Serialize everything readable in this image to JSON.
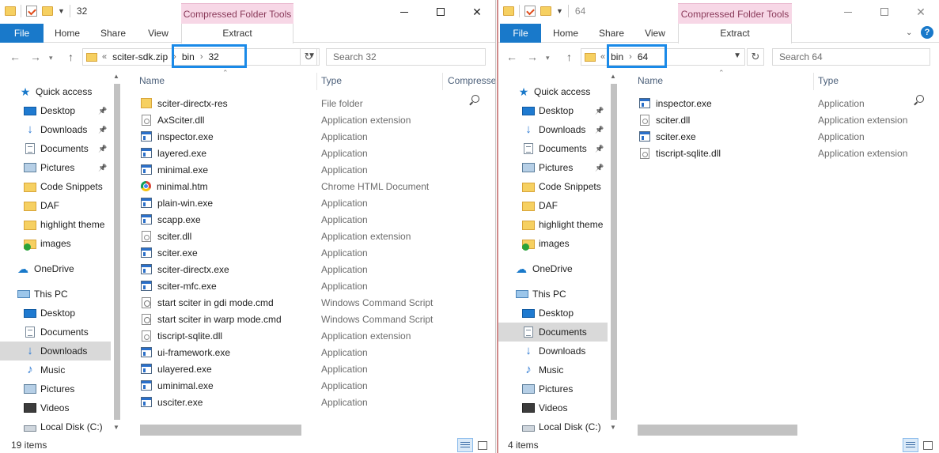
{
  "left": {
    "title": "32",
    "context_tab": "Compressed Folder Tools",
    "tabs": {
      "file": "File",
      "home": "Home",
      "share": "Share",
      "view": "View",
      "extract": "Extract"
    },
    "address": {
      "overflow": "«",
      "seg1": "sciter-sdk.zip",
      "seg2": "bin",
      "seg3": "32"
    },
    "search_placeholder": "Search 32",
    "nav": [
      {
        "label": "Quick access",
        "icon": "quick-access-star-icon"
      },
      {
        "label": "Desktop",
        "icon": "desktop-icon",
        "pinned": true
      },
      {
        "label": "Downloads",
        "icon": "downloads-icon",
        "pinned": true
      },
      {
        "label": "Documents",
        "icon": "documents-icon",
        "pinned": true
      },
      {
        "label": "Pictures",
        "icon": "pictures-icon",
        "pinned": true
      },
      {
        "label": "Code Snippets",
        "icon": "folder-icon"
      },
      {
        "label": "DAF",
        "icon": "folder-icon"
      },
      {
        "label": "highlight theme",
        "icon": "folder-icon"
      },
      {
        "label": "images",
        "icon": "folder-synced-icon"
      },
      {
        "label": "OneDrive",
        "icon": "onedrive-icon"
      },
      {
        "label": "This PC",
        "icon": "this-pc-icon"
      },
      {
        "label": "Desktop",
        "icon": "desktop-icon"
      },
      {
        "label": "Documents",
        "icon": "documents-icon"
      },
      {
        "label": "Downloads",
        "icon": "downloads-icon",
        "selected": true
      },
      {
        "label": "Music",
        "icon": "music-icon"
      },
      {
        "label": "Pictures",
        "icon": "pictures-icon"
      },
      {
        "label": "Videos",
        "icon": "videos-icon"
      },
      {
        "label": "Local Disk (C:)",
        "icon": "local-disk-icon"
      }
    ],
    "columns": {
      "name": "Name",
      "type": "Type",
      "compressed": "Compresse"
    },
    "files": [
      {
        "name": "sciter-directx-res",
        "type": "File folder",
        "icon": "folder"
      },
      {
        "name": "AxSciter.dll",
        "type": "Application extension",
        "icon": "dll"
      },
      {
        "name": "inspector.exe",
        "type": "Application",
        "icon": "app"
      },
      {
        "name": "layered.exe",
        "type": "Application",
        "icon": "app"
      },
      {
        "name": "minimal.exe",
        "type": "Application",
        "icon": "app"
      },
      {
        "name": "minimal.htm",
        "type": "Chrome HTML Document",
        "icon": "chrome"
      },
      {
        "name": "plain-win.exe",
        "type": "Application",
        "icon": "app"
      },
      {
        "name": "scapp.exe",
        "type": "Application",
        "icon": "app"
      },
      {
        "name": "sciter.dll",
        "type": "Application extension",
        "icon": "dll"
      },
      {
        "name": "sciter.exe",
        "type": "Application",
        "icon": "app"
      },
      {
        "name": "sciter-directx.exe",
        "type": "Application",
        "icon": "app"
      },
      {
        "name": "sciter-mfc.exe",
        "type": "Application",
        "icon": "app"
      },
      {
        "name": "start sciter in gdi mode.cmd",
        "type": "Windows Command Script",
        "icon": "cmd"
      },
      {
        "name": "start sciter in warp mode.cmd",
        "type": "Windows Command Script",
        "icon": "cmd"
      },
      {
        "name": "tiscript-sqlite.dll",
        "type": "Application extension",
        "icon": "dll"
      },
      {
        "name": "ui-framework.exe",
        "type": "Application",
        "icon": "app"
      },
      {
        "name": "ulayered.exe",
        "type": "Application",
        "icon": "app"
      },
      {
        "name": "uminimal.exe",
        "type": "Application",
        "icon": "app"
      },
      {
        "name": "usciter.exe",
        "type": "Application",
        "icon": "app"
      }
    ],
    "status": "19 items"
  },
  "right": {
    "title": "64",
    "context_tab": "Compressed Folder Tools",
    "tabs": {
      "file": "File",
      "home": "Home",
      "share": "Share",
      "view": "View",
      "extract": "Extract"
    },
    "address": {
      "overflow": "«",
      "seg1": "bin",
      "seg2": "64"
    },
    "search_placeholder": "Search 64",
    "nav": [
      {
        "label": "Quick access",
        "icon": "quick-access-star-icon"
      },
      {
        "label": "Desktop",
        "icon": "desktop-icon",
        "pinned": true
      },
      {
        "label": "Downloads",
        "icon": "downloads-icon",
        "pinned": true
      },
      {
        "label": "Documents",
        "icon": "documents-icon",
        "pinned": true
      },
      {
        "label": "Pictures",
        "icon": "pictures-icon",
        "pinned": true
      },
      {
        "label": "Code Snippets",
        "icon": "folder-icon"
      },
      {
        "label": "DAF",
        "icon": "folder-icon"
      },
      {
        "label": "highlight theme",
        "icon": "folder-icon"
      },
      {
        "label": "images",
        "icon": "folder-synced-icon"
      },
      {
        "label": "OneDrive",
        "icon": "onedrive-icon"
      },
      {
        "label": "This PC",
        "icon": "this-pc-icon"
      },
      {
        "label": "Desktop",
        "icon": "desktop-icon"
      },
      {
        "label": "Documents",
        "icon": "documents-icon",
        "selected": true
      },
      {
        "label": "Downloads",
        "icon": "downloads-icon"
      },
      {
        "label": "Music",
        "icon": "music-icon"
      },
      {
        "label": "Pictures",
        "icon": "pictures-icon"
      },
      {
        "label": "Videos",
        "icon": "videos-icon"
      },
      {
        "label": "Local Disk (C:)",
        "icon": "local-disk-icon"
      }
    ],
    "columns": {
      "name": "Name",
      "type": "Type"
    },
    "files": [
      {
        "name": "inspector.exe",
        "type": "Application",
        "icon": "app"
      },
      {
        "name": "sciter.dll",
        "type": "Application extension",
        "icon": "dll"
      },
      {
        "name": "sciter.exe",
        "type": "Application",
        "icon": "app"
      },
      {
        "name": "tiscript-sqlite.dll",
        "type": "Application extension",
        "icon": "dll"
      }
    ],
    "status": "4 items"
  },
  "colors": {
    "accent": "#1979ca",
    "highlight_box": "#1a8ae8",
    "context_tab_bg": "#f7d7e6",
    "selected_row": "#d9d9d9"
  }
}
